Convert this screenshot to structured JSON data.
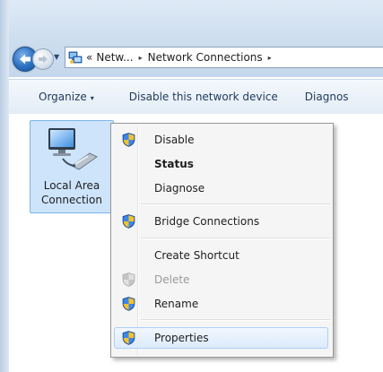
{
  "address_bar": {
    "crumb_prefix": "«",
    "crumb1": "Netw...",
    "separator": "▸",
    "crumb2": "Network Connections",
    "trailing_separator": "▸"
  },
  "command_bar": {
    "organize": "Organize",
    "organize_caret": "▾",
    "disable_device": "Disable this network device",
    "diagnose": "Diagnos"
  },
  "network_item": {
    "line1": "Local Area",
    "line2": "Connection"
  },
  "context_menu": {
    "disable": "Disable",
    "status": "Status",
    "diagnose": "Diagnose",
    "bridge": "Bridge Connections",
    "shortcut": "Create Shortcut",
    "delete": "Delete",
    "rename": "Rename",
    "properties": "Properties"
  },
  "icons": {
    "shield": "uac-shield-icon",
    "network": "network-adapter-icon",
    "back": "back-arrow-icon",
    "forward": "forward-arrow-icon"
  },
  "colors": {
    "selection_bg": "#cde4fb",
    "selection_border": "#7db4ea",
    "menu_hover_border": "#aecff7",
    "back_button": "#2a6fc0"
  }
}
